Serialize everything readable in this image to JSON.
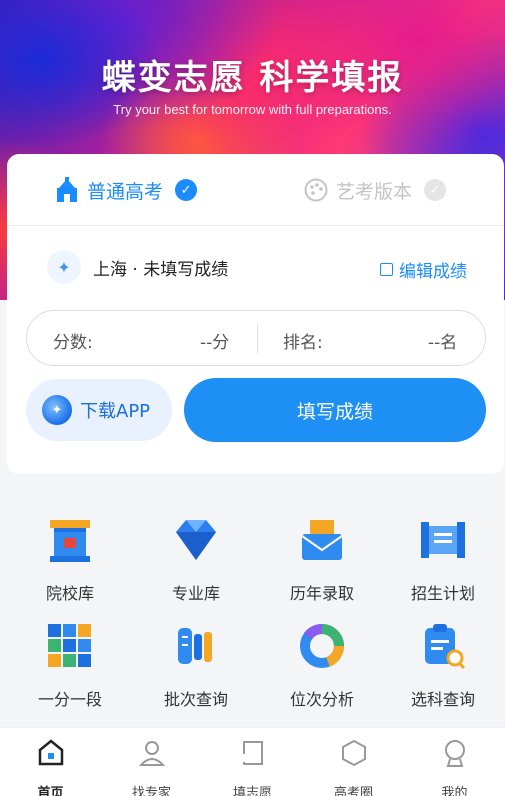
{
  "hero": {
    "title": "蝶变志愿 科学填报",
    "subtitle": "Try your best for tomorrow with full preparations."
  },
  "tabs": [
    {
      "label": "普通高考",
      "icon": "school-icon",
      "active": true
    },
    {
      "label": "艺考版本",
      "icon": "palette-icon",
      "active": false
    }
  ],
  "location": {
    "text": "上海 · 未填写成绩",
    "edit_label": "编辑成绩"
  },
  "score": {
    "score_label": "分数:",
    "score_value": "--分",
    "rank_label": "排名:",
    "rank_value": "--名"
  },
  "buttons": {
    "download_label": "下载APP",
    "fill_label": "填写成绩"
  },
  "features": [
    {
      "label": "院校库",
      "icon": "university-icon"
    },
    {
      "label": "专业库",
      "icon": "diamond-icon"
    },
    {
      "label": "历年录取",
      "icon": "mail-icon"
    },
    {
      "label": "招生计划",
      "icon": "scroll-icon"
    },
    {
      "label": "一分一段",
      "icon": "grid-icon"
    },
    {
      "label": "批次查询",
      "icon": "batch-icon"
    },
    {
      "label": "位次分析",
      "icon": "donut-chart-icon"
    },
    {
      "label": "选科查询",
      "icon": "clipboard-search-icon"
    }
  ],
  "nav": [
    {
      "label": "首页",
      "icon": "home-icon",
      "active": true
    },
    {
      "label": "找专家",
      "icon": "expert-icon",
      "active": false
    },
    {
      "label": "填志愿",
      "icon": "form-icon",
      "active": false
    },
    {
      "label": "高考圈",
      "icon": "hexagon-icon",
      "active": false
    },
    {
      "label": "我的",
      "icon": "profile-icon",
      "active": false
    }
  ],
  "colors": {
    "accent": "#1e8ff5",
    "inactive": "#c4c4c4"
  }
}
